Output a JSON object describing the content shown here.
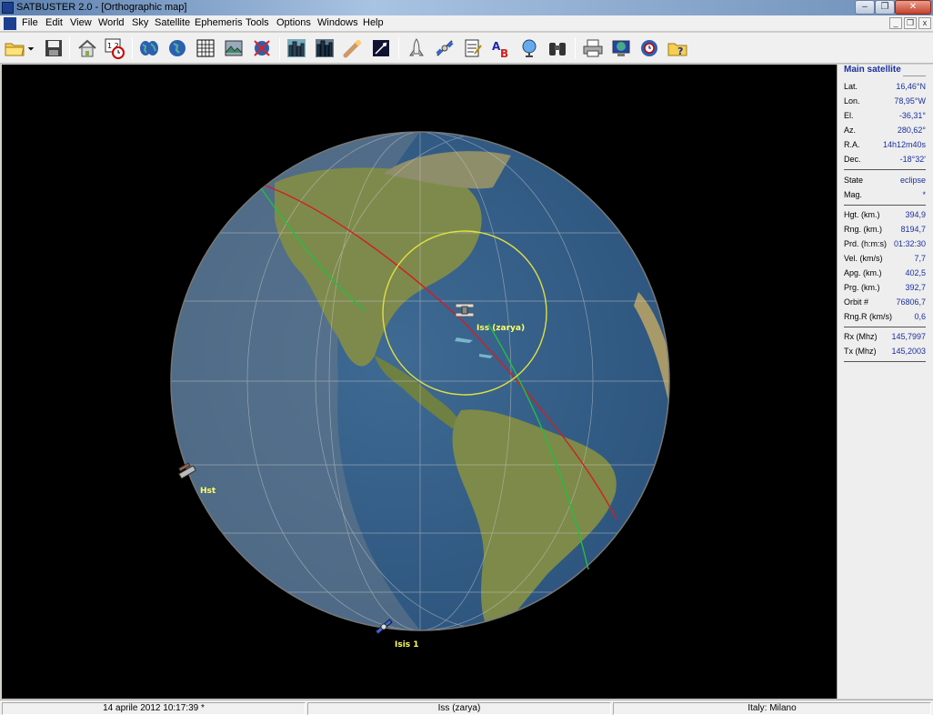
{
  "window": {
    "title": "SATBUSTER 2.0 - [Orthographic map]",
    "controls": [
      "minimize",
      "restore",
      "close"
    ]
  },
  "menu": {
    "items": [
      "File",
      "Edit",
      "View",
      "World",
      "Sky",
      "Satellite",
      "Ephemeris",
      "Tools",
      "Options",
      "Windows",
      "Help"
    ]
  },
  "toolbar": {
    "icons": [
      "open-folder-icon",
      "dropdown-arrow-icon",
      "save-icon",
      "home-icon",
      "calendar-clock-icon",
      "world-map-icon",
      "globe-icon",
      "grid-icon",
      "landscape-icon",
      "target-globe-icon",
      "city-day-icon",
      "city-night-icon",
      "comet-icon",
      "star-chart-icon",
      "shuttle-icon",
      "satellite-icon",
      "notes-icon",
      "text-ab-icon",
      "dish-icon",
      "binoculars-icon",
      "printer-icon",
      "monitor-globe-icon",
      "globe-clock-icon",
      "help-icon"
    ]
  },
  "map": {
    "satellites": [
      {
        "name": "Iss (zarya)",
        "color": "#ffff60"
      },
      {
        "name": "Hst",
        "color": "#ffff60"
      },
      {
        "name": "Isis 1",
        "color": "#ffff60"
      }
    ],
    "colors": {
      "ocean": "#2f5a86",
      "land": "#7d8a4a",
      "coverage": "#e0e040",
      "track_red": "#d02020",
      "track_green": "#20c040"
    }
  },
  "panel": {
    "title": "Main satellite",
    "group1": [
      {
        "label": "Lat.",
        "value": "16,46°N"
      },
      {
        "label": "Lon.",
        "value": "78,95°W"
      },
      {
        "label": "El.",
        "value": "-36,31°"
      },
      {
        "label": "Az.",
        "value": "280,62°"
      },
      {
        "label": "R.A.",
        "value": "14h12m40s"
      },
      {
        "label": "Dec.",
        "value": "-18°32'"
      }
    ],
    "group2": [
      {
        "label": "State",
        "value": "eclipse"
      },
      {
        "label": "Mag.",
        "value": "*"
      }
    ],
    "group3": [
      {
        "label": "Hgt. (km.)",
        "value": "394,9"
      },
      {
        "label": "Rng. (km.)",
        "value": "8194,7"
      },
      {
        "label": "Prd. (h:m:s)",
        "value": "01:32:30"
      },
      {
        "label": "Vel. (km/s)",
        "value": "7,7"
      },
      {
        "label": "Apg. (km.)",
        "value": "402,5"
      },
      {
        "label": "Prg. (km.)",
        "value": "392,7"
      },
      {
        "label": "Orbit #",
        "value": "76806,7"
      },
      {
        "label": "Rng.R (km/s)",
        "value": "0,6"
      }
    ],
    "group4": [
      {
        "label": "Rx (Mhz)",
        "value": "145,7997"
      },
      {
        "label": "Tx (Mhz)",
        "value": "145,2003"
      }
    ]
  },
  "status": {
    "datetime": "14 aprile 2012  10:17:39 *",
    "satellite": "Iss (zarya)",
    "location": "Italy: Milano"
  }
}
